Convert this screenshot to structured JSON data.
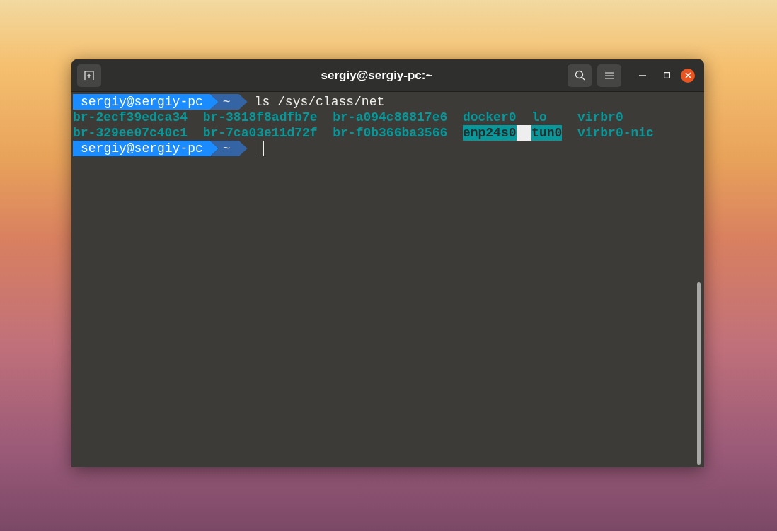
{
  "window": {
    "title": "sergiy@sergiy-pc:~"
  },
  "lines": [
    {
      "kind": "prompt",
      "user_host": "sergiy@sergiy-pc",
      "dir": "~",
      "command": "ls /sys/class/net",
      "cursor": false
    },
    {
      "kind": "output",
      "entries": [
        {
          "text": "br-2ecf39edca34",
          "highlighted": false
        },
        {
          "text": "br-3818f8adfb7e",
          "highlighted": false
        },
        {
          "text": "br-a094c86817e6",
          "highlighted": false
        },
        {
          "text": "docker0",
          "highlighted": false
        },
        {
          "text": "lo",
          "highlighted": false
        },
        {
          "text": "virbr0",
          "highlighted": false
        }
      ]
    },
    {
      "kind": "output",
      "entries": [
        {
          "text": "br-329ee07c40c1",
          "highlighted": false
        },
        {
          "text": "br-7ca03e11d72f",
          "highlighted": false
        },
        {
          "text": "br-f0b366ba3566",
          "highlighted": false
        },
        {
          "text": "enp24s0",
          "highlighted": true
        },
        {
          "text": "tun0",
          "highlighted": true
        },
        {
          "text": "virbr0-nic",
          "highlighted": false
        }
      ]
    },
    {
      "kind": "prompt",
      "user_host": "sergiy@sergiy-pc",
      "dir": "~",
      "cursor": true
    }
  ]
}
